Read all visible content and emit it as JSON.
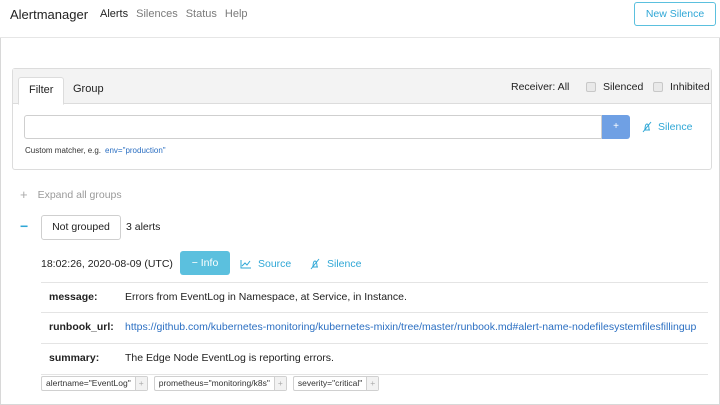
{
  "navbar": {
    "brand": "Alertmanager",
    "links": [
      "Alerts",
      "Silences",
      "Status",
      "Help"
    ],
    "new_silence_label": "New Silence"
  },
  "filter_panel": {
    "tabs": [
      "Filter",
      "Group"
    ],
    "receiver_label": "Receiver: All",
    "silenced_label": "Silenced",
    "inhibited_label": "Inhibited",
    "input_value": "",
    "add_button_label": "+",
    "silence_label": "Silence",
    "hint_text": "Custom matcher, e.g.",
    "hint_example": "env=\"production\""
  },
  "groups": {
    "expand_all_label": "Expand all groups",
    "group_name": "Not grouped",
    "alert_count": "3 alerts"
  },
  "alert": {
    "timestamp": "18:02:26, 2020-08-09 (UTC)",
    "info_label": "Info",
    "source_label": "Source",
    "silence_label": "Silence",
    "annotations": [
      {
        "key": "message:",
        "value": "Errors from EventLog in Namespace, at Service, in Instance."
      },
      {
        "key": "runbook_url:",
        "value": "https://github.com/kubernetes-monitoring/kubernetes-mixin/tree/master/runbook.md#alert-name-nodefilesystemfilesfillingup"
      },
      {
        "key": "summary:",
        "value": "The Edge Node EventLog is reporting errors."
      }
    ],
    "labels": [
      "alertname=\"EventLog\"",
      "prometheus=\"monitoring/k8s\"",
      "severity=\"critical\""
    ],
    "label_add_glyph": "+"
  }
}
